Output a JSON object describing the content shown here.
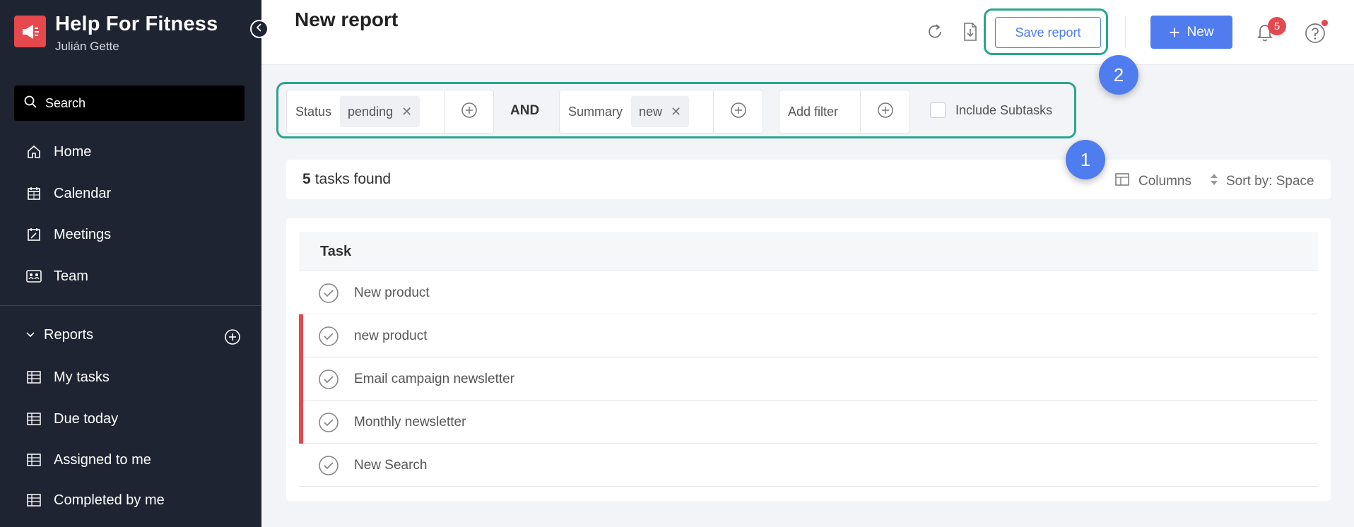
{
  "brand": {
    "name": "Help For Fitness",
    "user": "Julián Gette",
    "logo_icon": "megaphone-icon",
    "accent": "#e5484d"
  },
  "sidebar": {
    "search_label": "Search",
    "items": [
      {
        "label": "Home",
        "icon": "home-icon"
      },
      {
        "label": "Calendar",
        "icon": "calendar-icon"
      },
      {
        "label": "Meetings",
        "icon": "meetings-icon"
      },
      {
        "label": "Team",
        "icon": "team-icon"
      }
    ],
    "reports": {
      "label": "Reports",
      "items": [
        {
          "label": "My tasks"
        },
        {
          "label": "Due today"
        },
        {
          "label": "Assigned to me"
        },
        {
          "label": "Completed by me"
        }
      ]
    }
  },
  "header": {
    "title": "New report",
    "save_label": "Save report",
    "new_label": "New",
    "notification_count": "5",
    "primary_color": "#4f7df0"
  },
  "steps": {
    "one": "1",
    "two": "2"
  },
  "filters": {
    "status": {
      "label": "Status",
      "value": "pending"
    },
    "and_label": "AND",
    "summary": {
      "label": "Summary",
      "value": "new"
    },
    "add_label": "Add filter",
    "subtasks_label": "Include Subtasks"
  },
  "results": {
    "count": "5",
    "count_label": "tasks found",
    "columns_label": "Columns",
    "sort_label": "Sort by: Space"
  },
  "table": {
    "header": "Task",
    "rows": [
      {
        "title": "New product",
        "flagged": false
      },
      {
        "title": "new product",
        "flagged": true
      },
      {
        "title": "Email campaign newsletter",
        "flagged": true
      },
      {
        "title": "Monthly newsletter",
        "flagged": true
      },
      {
        "title": "New Search",
        "flagged": false
      }
    ]
  }
}
